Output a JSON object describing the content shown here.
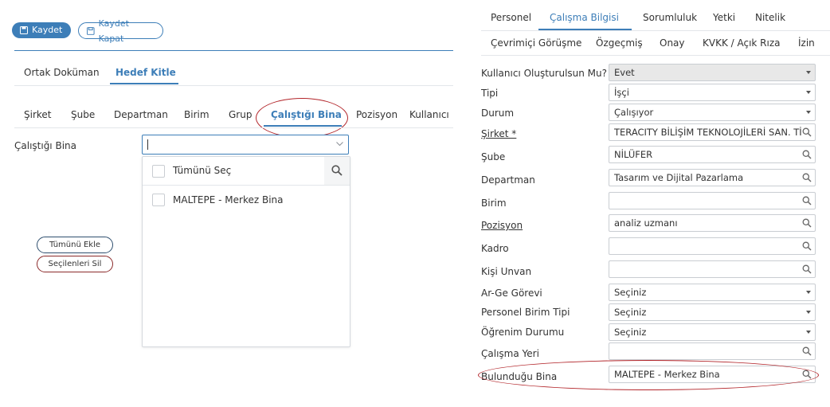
{
  "toolbar": {
    "save_label": "Kaydet",
    "save_close_label": "Kaydet Kapat"
  },
  "doc_tabs": [
    {
      "label": "Ortak Doküman"
    },
    {
      "label": "Hedef Kitle"
    }
  ],
  "filter_tabs": [
    {
      "label": "Şirket"
    },
    {
      "label": "Şube"
    },
    {
      "label": "Departman"
    },
    {
      "label": "Birim"
    },
    {
      "label": "Grup"
    },
    {
      "label": "Çalıştığı Bina"
    },
    {
      "label": "Pozisyon"
    },
    {
      "label": "Kullanıcı"
    }
  ],
  "building_filter": {
    "label": "Çalıştığı Bina",
    "input_value": "",
    "select_all_label": "Tümünü Seç",
    "options": [
      {
        "label": "MALTEPE - Merkez Bina",
        "checked": false
      }
    ]
  },
  "actions": {
    "add_all_label": "Tümünü Ekle",
    "remove_selected_label": "Seçilenleri Sil"
  },
  "right_tabs_row1": [
    {
      "label": "Personel"
    },
    {
      "label": "Çalışma Bilgisi"
    },
    {
      "label": "Sorumluluk"
    },
    {
      "label": "Yetki"
    },
    {
      "label": "Nitelik"
    }
  ],
  "right_tabs_row2": [
    {
      "label": "Çevrimiçi Görüşme"
    },
    {
      "label": "Özgeçmiş"
    },
    {
      "label": "Onay"
    },
    {
      "label": "KVKK / Açık Rıza"
    },
    {
      "label": "İzin"
    }
  ],
  "form": {
    "create_user": {
      "label": "Kullanıcı Oluşturulsun Mu?",
      "value": "Evet"
    },
    "type": {
      "label": "Tipi",
      "value": "İşçi"
    },
    "status": {
      "label": "Durum",
      "value": "Çalışıyor"
    },
    "company": {
      "label": "Şirket *",
      "value": "TERACITY BİLİŞİM TEKNOLOJİLERİ SAN. TİC"
    },
    "branch": {
      "label": "Şube",
      "value": "NİLÜFER"
    },
    "department": {
      "label": "Departman",
      "value": "Tasarım ve Dijital Pazarlama"
    },
    "unit": {
      "label": "Birim",
      "value": ""
    },
    "position": {
      "label": "Pozisyon",
      "value": "analiz uzmanı"
    },
    "staff": {
      "label": "Kadro",
      "value": ""
    },
    "person_title": {
      "label": "Kişi Unvan",
      "value": ""
    },
    "rnd_duty": {
      "label": "Ar-Ge Görevi",
      "value": "Seçiniz"
    },
    "unit_type": {
      "label": "Personel Birim Tipi",
      "value": "Seçiniz"
    },
    "education": {
      "label": "Öğrenim Durumu",
      "value": "Seçiniz"
    },
    "work_place": {
      "label": "Çalışma Yeri",
      "value": ""
    },
    "building": {
      "label": "Bulunduğu Bina",
      "value": "MALTEPE - Merkez Bina"
    }
  },
  "colors": {
    "accent": "#3d7eb8",
    "highlight_ring": "#b3262b",
    "readonly_bg": "#e8e8e8"
  }
}
